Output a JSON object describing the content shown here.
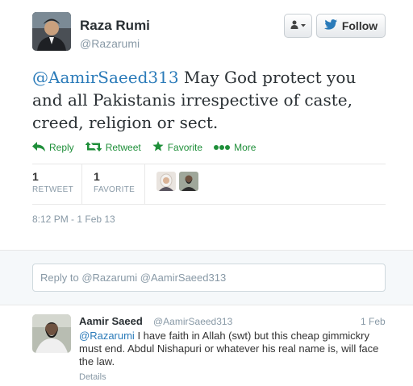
{
  "tweet": {
    "author_name": "Raza Rumi",
    "author_handle": "@Razarumi",
    "follow_label": "Follow",
    "mention": "@AamirSaeed313",
    "text": " May God protect you and all Pakistanis irrespective of caste, creed, religion or sect.",
    "actions": {
      "reply": "Reply",
      "retweet": "Retweet",
      "favorite": "Favorite",
      "more": "More"
    },
    "stats": {
      "retweets_count": "1",
      "retweets_label": "RETWEET",
      "favorites_count": "1",
      "favorites_label": "FAVORITE"
    },
    "timestamp": "8:12 PM - 1 Feb 13"
  },
  "reply_box": {
    "placeholder_prefix": "Reply to ",
    "mentions": "@Razarumi @AamirSaeed313"
  },
  "reply": {
    "author_name": "Aamir Saeed",
    "author_handle": "@AamirSaeed313",
    "date": "1 Feb",
    "mention": "@Razarumi",
    "text": " I have faith in Allah (swt) but this cheap gimmickry must end. Abdul Nishapuri or whatever his real name is, will face the law.",
    "details_label": "Details"
  },
  "colors": {
    "accent": "#1f8f3a",
    "link": "#2b7bb9",
    "muted": "#8899a6"
  },
  "icons": [
    "user-dropdown-icon",
    "bird-icon",
    "reply-icon",
    "retweet-icon",
    "star-icon",
    "more-icon"
  ]
}
